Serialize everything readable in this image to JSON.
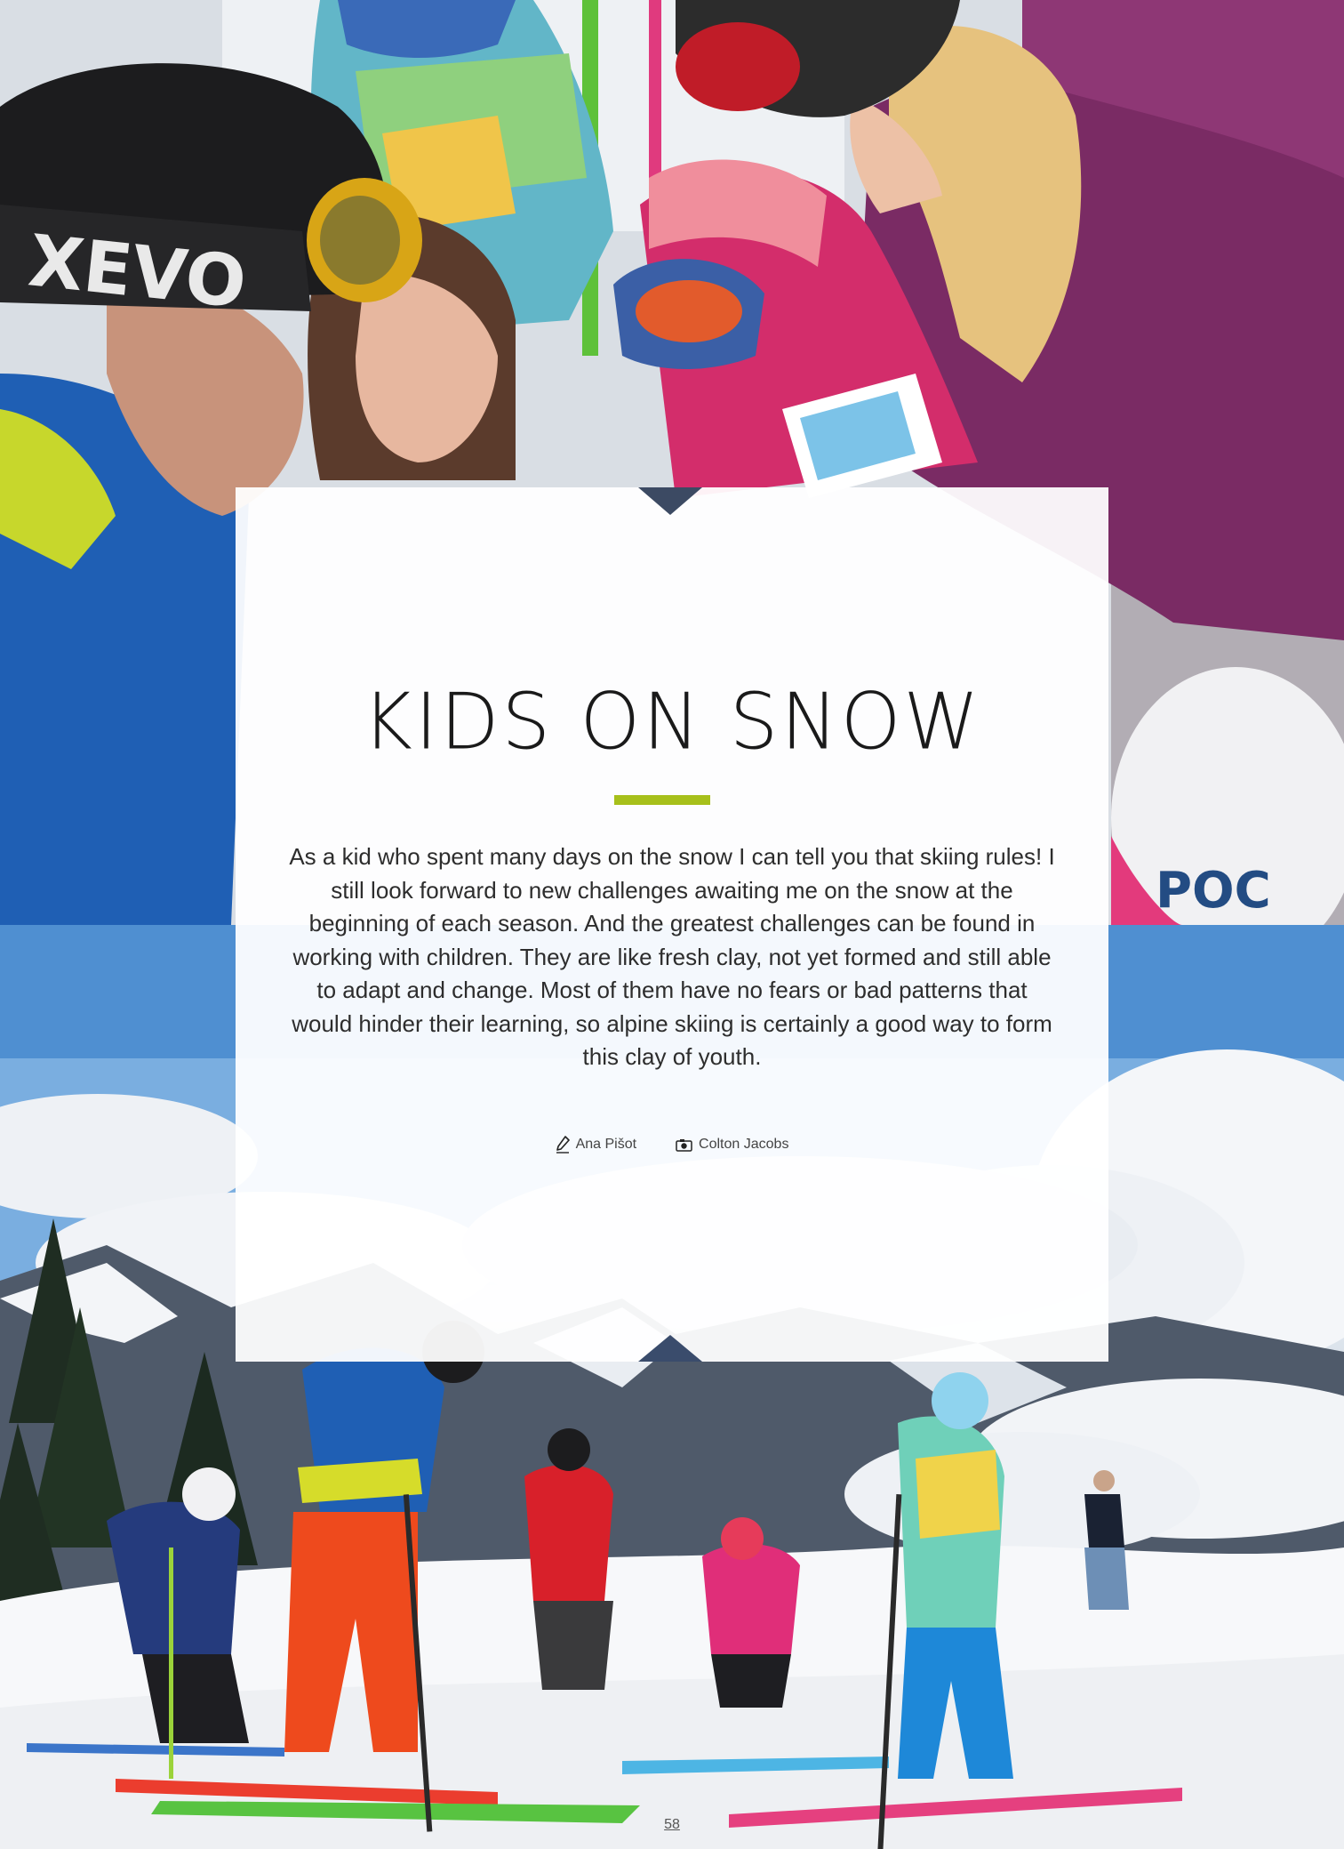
{
  "article": {
    "title": "KIDS ON SNOW",
    "lead": "As a kid who spent many days on the snow I can tell you that skiing rules! I still look forward to new challenges awaiting me on the snow at the beginning of each season. And the greatest challenges can be found in working with children. They are like fresh clay, not yet formed and still able to adapt and change. Most of them have no fears or bad patterns that would hinder their learning, so alpine skiing is certainly a good way to form this clay of youth.",
    "accent_color": "#a7c01b"
  },
  "credits": {
    "author": {
      "icon": "pencil-icon",
      "name": "Ana Pišot"
    },
    "photographer": {
      "icon": "camera-icon",
      "name": "Colton Jacobs"
    }
  },
  "photos": {
    "top": {
      "helmet_brand": "XEVO",
      "helmet_brand_2": "POC"
    },
    "bottom": {}
  },
  "page": {
    "number": "58"
  }
}
